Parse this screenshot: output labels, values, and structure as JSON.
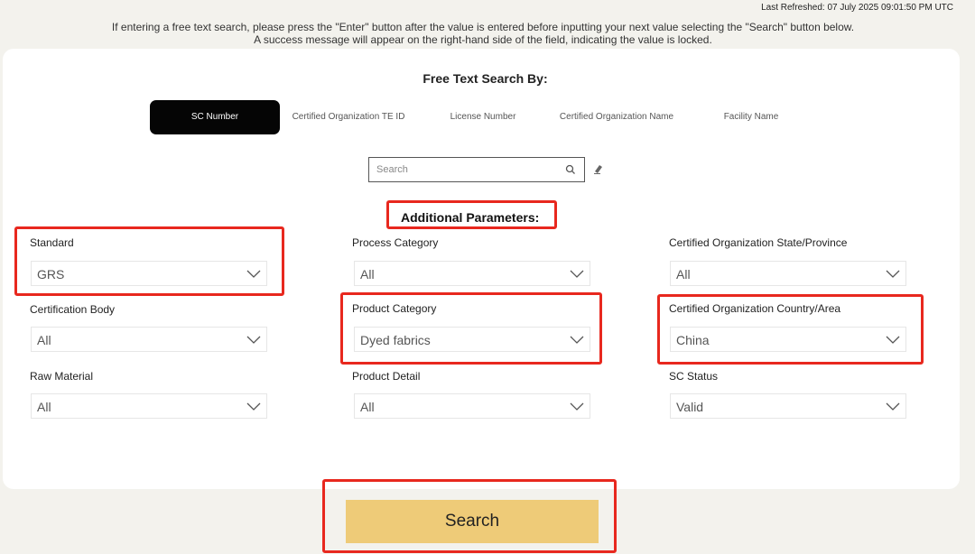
{
  "header": {
    "last_refreshed": "Last Refreshed: 07 July 2025 09:01:50 PM UTC",
    "notice_line1": "If entering a free text search, please press the \"Enter\" button after the value is entered before inputting your next value selecting the \"Search\" button below.",
    "notice_line2": "A success message will appear on the right-hand side of the field, indicating the value is locked."
  },
  "free_text": {
    "title": "Free Text Search By:",
    "tabs": [
      {
        "label": "SC Number",
        "active": true
      },
      {
        "label": "Certified Organization TE ID",
        "active": false
      },
      {
        "label": "License Number",
        "active": false
      },
      {
        "label": "Certified Organization Name",
        "active": false
      },
      {
        "label": "Facility Name",
        "active": false
      }
    ],
    "search_placeholder": "Search",
    "icons": {
      "search": "search-icon",
      "clear": "eraser-icon"
    }
  },
  "additional": {
    "title": "Additional Parameters:",
    "filters": [
      {
        "label": "Standard",
        "value": "GRS"
      },
      {
        "label": "Process Category",
        "value": "All"
      },
      {
        "label": "Certified Organization State/Province",
        "value": "All"
      },
      {
        "label": "Certification Body",
        "value": "All"
      },
      {
        "label": "Product Category",
        "value": "Dyed fabrics"
      },
      {
        "label": "Certified Organization Country/Area",
        "value": "China"
      },
      {
        "label": "Raw Material",
        "value": "All"
      },
      {
        "label": "Product Detail",
        "value": "All"
      },
      {
        "label": "SC Status",
        "value": "Valid"
      }
    ]
  },
  "actions": {
    "search_label": "Search"
  },
  "colors": {
    "accent_button": "#eecb78",
    "highlight": "#e8281e",
    "active_tab": "#050505"
  }
}
